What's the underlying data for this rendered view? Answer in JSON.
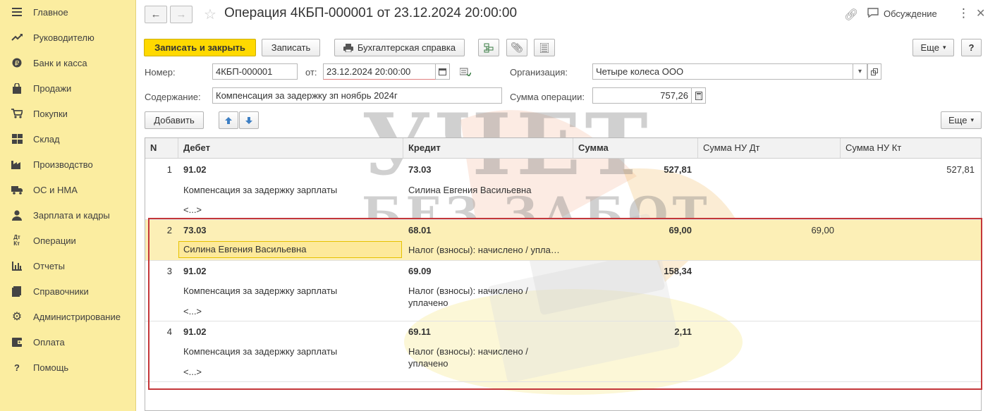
{
  "sidebar": {
    "items": [
      {
        "label": "Главное",
        "icon": "menu-icon"
      },
      {
        "label": "Руководителю",
        "icon": "trend-icon"
      },
      {
        "label": "Банк и касса",
        "icon": "coin-icon"
      },
      {
        "label": "Продажи",
        "icon": "bag-icon"
      },
      {
        "label": "Покупки",
        "icon": "cart-icon"
      },
      {
        "label": "Склад",
        "icon": "grid-icon"
      },
      {
        "label": "Производство",
        "icon": "factory-icon"
      },
      {
        "label": "ОС и НМА",
        "icon": "truck-icon"
      },
      {
        "label": "Зарплата и кадры",
        "icon": "person-icon"
      },
      {
        "label": "Операции",
        "icon": "operations-icon"
      },
      {
        "label": "Отчеты",
        "icon": "chart-icon"
      },
      {
        "label": "Справочники",
        "icon": "book-icon"
      },
      {
        "label": "Администрирование",
        "icon": "gear-icon"
      },
      {
        "label": "Оплата",
        "icon": "wallet-icon"
      },
      {
        "label": "Помощь",
        "icon": "help-icon"
      }
    ]
  },
  "header": {
    "title": "Операция 4КБП-000001 от 23.12.2024 20:00:00",
    "discussion": "Обсуждение"
  },
  "toolbar": {
    "save_close": "Записать и закрыть",
    "save": "Записать",
    "report": "Бухгалтерская справка",
    "more": "Еще",
    "help": "?"
  },
  "form": {
    "number_label": "Номер:",
    "number_value": "4КБП-000001",
    "date_label": "от:",
    "date_value": "23.12.2024 20:00:00",
    "org_label": "Организация:",
    "org_value": "Четыре колеса ООО",
    "content_label": "Содержание:",
    "content_value": "Компенсация за задержку зп ноябрь 2024г",
    "sum_label": "Сумма операции:",
    "sum_value": "757,26"
  },
  "table_toolbar": {
    "add": "Добавить",
    "more": "Еще"
  },
  "table": {
    "headers": [
      "N",
      "Дебет",
      "Кредит",
      "Сумма",
      "Сумма НУ Дт",
      "Сумма НУ Кт"
    ],
    "rows": [
      {
        "n": "1",
        "debit": "91.02",
        "debit_sub1": "Компенсация за задержку зарплаты",
        "debit_sub2": "<...>",
        "credit": "73.03",
        "credit_sub1": "Силина Евгения Васильевна",
        "credit_sub2": "",
        "sum": "527,81",
        "nu_dt": "",
        "nu_kt": "527,81"
      },
      {
        "n": "2",
        "debit": "73.03",
        "debit_sub1": "Силина Евгения Васильевна",
        "debit_sub2": "",
        "credit": "68.01",
        "credit_sub1": "Налог (взносы): начислено / упла…",
        "credit_sub2": "",
        "sum": "69,00",
        "nu_dt": "69,00",
        "nu_kt": ""
      },
      {
        "n": "3",
        "debit": "91.02",
        "debit_sub1": "Компенсация за задержку зарплаты",
        "debit_sub2": "<...>",
        "credit": "69.09",
        "credit_sub1": "Налог (взносы): начислено /",
        "credit_sub2": "уплачено",
        "sum": "158,34",
        "nu_dt": "",
        "nu_kt": ""
      },
      {
        "n": "4",
        "debit": "91.02",
        "debit_sub1": "Компенсация за задержку зарплаты",
        "debit_sub2": "<...>",
        "credit": "69.11",
        "credit_sub1": "Налог (взносы): начислено /",
        "credit_sub2": "уплачено",
        "sum": "2,11",
        "nu_dt": "",
        "nu_kt": ""
      }
    ]
  },
  "watermark": {
    "line1": "УЧЕТ",
    "line2": "БЕЗ ЗАБОТ"
  }
}
